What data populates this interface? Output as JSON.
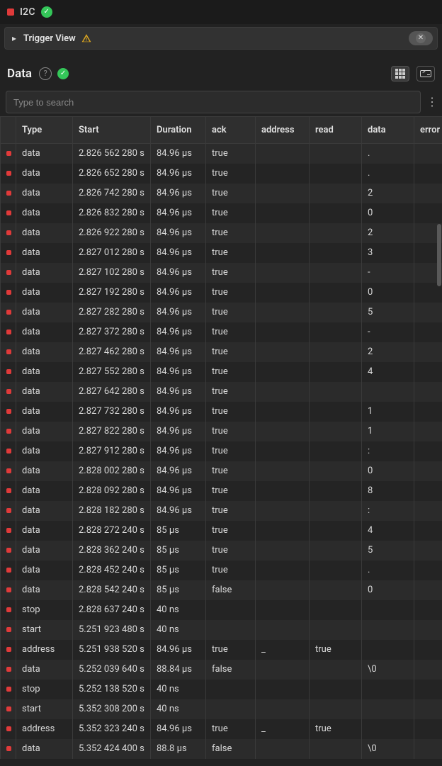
{
  "header": {
    "title": "I2C"
  },
  "trigger_bar": {
    "label": "Trigger View"
  },
  "data_section": {
    "title": "Data",
    "search_placeholder": "Type to search"
  },
  "columns": [
    {
      "key": "type",
      "label": "Type"
    },
    {
      "key": "start",
      "label": "Start"
    },
    {
      "key": "duration",
      "label": "Duration"
    },
    {
      "key": "ack",
      "label": "ack"
    },
    {
      "key": "address",
      "label": "address"
    },
    {
      "key": "read",
      "label": "read"
    },
    {
      "key": "data",
      "label": "data"
    },
    {
      "key": "error",
      "label": "error"
    }
  ],
  "rows": [
    {
      "type": "data",
      "start": "2.826 562 280 s",
      "duration": "84.96 µs",
      "ack": "true",
      "address": "",
      "read": "",
      "data": ".",
      "error": ""
    },
    {
      "type": "data",
      "start": "2.826 652 280 s",
      "duration": "84.96 µs",
      "ack": "true",
      "address": "",
      "read": "",
      "data": ".",
      "error": ""
    },
    {
      "type": "data",
      "start": "2.826 742 280 s",
      "duration": "84.96 µs",
      "ack": "true",
      "address": "",
      "read": "",
      "data": "2",
      "error": ""
    },
    {
      "type": "data",
      "start": "2.826 832 280 s",
      "duration": "84.96 µs",
      "ack": "true",
      "address": "",
      "read": "",
      "data": "0",
      "error": ""
    },
    {
      "type": "data",
      "start": "2.826 922 280 s",
      "duration": "84.96 µs",
      "ack": "true",
      "address": "",
      "read": "",
      "data": "2",
      "error": ""
    },
    {
      "type": "data",
      "start": "2.827 012 280 s",
      "duration": "84.96 µs",
      "ack": "true",
      "address": "",
      "read": "",
      "data": "3",
      "error": ""
    },
    {
      "type": "data",
      "start": "2.827 102 280 s",
      "duration": "84.96 µs",
      "ack": "true",
      "address": "",
      "read": "",
      "data": "-",
      "error": ""
    },
    {
      "type": "data",
      "start": "2.827 192 280 s",
      "duration": "84.96 µs",
      "ack": "true",
      "address": "",
      "read": "",
      "data": "0",
      "error": ""
    },
    {
      "type": "data",
      "start": "2.827 282 280 s",
      "duration": "84.96 µs",
      "ack": "true",
      "address": "",
      "read": "",
      "data": "5",
      "error": ""
    },
    {
      "type": "data",
      "start": "2.827 372 280 s",
      "duration": "84.96 µs",
      "ack": "true",
      "address": "",
      "read": "",
      "data": "-",
      "error": ""
    },
    {
      "type": "data",
      "start": "2.827 462 280 s",
      "duration": "84.96 µs",
      "ack": "true",
      "address": "",
      "read": "",
      "data": "2",
      "error": ""
    },
    {
      "type": "data",
      "start": "2.827 552 280 s",
      "duration": "84.96 µs",
      "ack": "true",
      "address": "",
      "read": "",
      "data": "4",
      "error": ""
    },
    {
      "type": "data",
      "start": "2.827 642 280 s",
      "duration": "84.96 µs",
      "ack": "true",
      "address": "",
      "read": "",
      "data": "",
      "error": ""
    },
    {
      "type": "data",
      "start": "2.827 732 280 s",
      "duration": "84.96 µs",
      "ack": "true",
      "address": "",
      "read": "",
      "data": "1",
      "error": ""
    },
    {
      "type": "data",
      "start": "2.827 822 280 s",
      "duration": "84.96 µs",
      "ack": "true",
      "address": "",
      "read": "",
      "data": "1",
      "error": ""
    },
    {
      "type": "data",
      "start": "2.827 912 280 s",
      "duration": "84.96 µs",
      "ack": "true",
      "address": "",
      "read": "",
      "data": ":",
      "error": ""
    },
    {
      "type": "data",
      "start": "2.828 002 280 s",
      "duration": "84.96 µs",
      "ack": "true",
      "address": "",
      "read": "",
      "data": "0",
      "error": ""
    },
    {
      "type": "data",
      "start": "2.828 092 280 s",
      "duration": "84.96 µs",
      "ack": "true",
      "address": "",
      "read": "",
      "data": "8",
      "error": ""
    },
    {
      "type": "data",
      "start": "2.828 182 280 s",
      "duration": "84.96 µs",
      "ack": "true",
      "address": "",
      "read": "",
      "data": ":",
      "error": ""
    },
    {
      "type": "data",
      "start": "2.828 272 240 s",
      "duration": "85 µs",
      "ack": "true",
      "address": "",
      "read": "",
      "data": "4",
      "error": ""
    },
    {
      "type": "data",
      "start": "2.828 362 240 s",
      "duration": "85 µs",
      "ack": "true",
      "address": "",
      "read": "",
      "data": "5",
      "error": ""
    },
    {
      "type": "data",
      "start": "2.828 452 240 s",
      "duration": "85 µs",
      "ack": "true",
      "address": "",
      "read": "",
      "data": ".",
      "error": ""
    },
    {
      "type": "data",
      "start": "2.828 542 240 s",
      "duration": "85 µs",
      "ack": "false",
      "address": "",
      "read": "",
      "data": "0",
      "error": ""
    },
    {
      "type": "stop",
      "start": "2.828 637 240 s",
      "duration": "40 ns",
      "ack": "",
      "address": "",
      "read": "",
      "data": "",
      "error": ""
    },
    {
      "type": "start",
      "start": "5.251 923 480 s",
      "duration": "40 ns",
      "ack": "",
      "address": "",
      "read": "",
      "data": "",
      "error": ""
    },
    {
      "type": "address",
      "start": "5.251 938 520 s",
      "duration": "84.96 µs",
      "ack": "true",
      "address": "_",
      "read": "true",
      "data": "",
      "error": ""
    },
    {
      "type": "data",
      "start": "5.252 039 640 s",
      "duration": "88.84 µs",
      "ack": "false",
      "address": "",
      "read": "",
      "data": "\\0",
      "error": ""
    },
    {
      "type": "stop",
      "start": "5.252 138 520 s",
      "duration": "40 ns",
      "ack": "",
      "address": "",
      "read": "",
      "data": "",
      "error": ""
    },
    {
      "type": "start",
      "start": "5.352 308 200 s",
      "duration": "40 ns",
      "ack": "",
      "address": "",
      "read": "",
      "data": "",
      "error": ""
    },
    {
      "type": "address",
      "start": "5.352 323 240 s",
      "duration": "84.96 µs",
      "ack": "true",
      "address": "_",
      "read": "true",
      "data": "",
      "error": ""
    },
    {
      "type": "data",
      "start": "5.352 424 400 s",
      "duration": "88.8 µs",
      "ack": "false",
      "address": "",
      "read": "",
      "data": "\\0",
      "error": ""
    }
  ],
  "scroll": {
    "thumb_top_pct": 13,
    "thumb_height_pct": 10
  }
}
